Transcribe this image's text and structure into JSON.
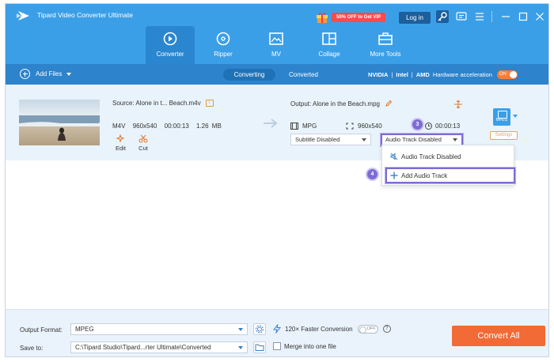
{
  "app": {
    "title": "Tipard Video Converter Ultimate",
    "promo": "50% OFF to Get VIP",
    "login": "Log in"
  },
  "nav": [
    {
      "label": "Converter",
      "icon": "converter-icon",
      "active": true
    },
    {
      "label": "Ripper",
      "icon": "ripper-disc-icon"
    },
    {
      "label": "MV",
      "icon": "mv-image-icon"
    },
    {
      "label": "Collage",
      "icon": "collage-grid-icon"
    },
    {
      "label": "More Tools",
      "icon": "toolbox-icon"
    }
  ],
  "toolbar": {
    "add_files": "Add Files",
    "tab_converting": "Converting",
    "tab_converted": "Converted",
    "gpu_nvidia": "NVIDIA",
    "gpu_intel": "Intel",
    "gpu_amd": "AMD",
    "hw_accel": "Hardware acceleration",
    "hw_accel_state": "ON"
  },
  "file": {
    "source": "Source: Alone in t... Beach.m4v",
    "source_format": "M4V",
    "source_resolution": "960x540",
    "source_duration": "00:00:13",
    "source_size": "1.26 MB",
    "edit": "Edit",
    "cut": "Cut",
    "output": "Output: Alone in the Beach.mpg",
    "out_format": "MPG",
    "out_resolution": "960x540",
    "out_duration": "00:00:13",
    "subtitle": "Subtitle Disabled",
    "audio": "Audio Track Disabled",
    "format_badge": "MPEG",
    "settings": "Settings"
  },
  "badges": {
    "step3": "3",
    "step4": "4"
  },
  "dropdown": {
    "item_disabled": "Audio Track Disabled",
    "item_add": "Add Audio Track"
  },
  "footer": {
    "output_format_label": "Output Format:",
    "output_format_value": "MPEG",
    "save_to_label": "Save to:",
    "save_to_value": "C:\\Tipard Studio\\Tipard...rter Ultimate\\Converted",
    "faster": "120× Faster Conversion",
    "faster_state": "OFF",
    "merge": "Merge into one file",
    "convert_all": "Convert All"
  },
  "colors": {
    "header": "#3b9fe8",
    "toolbar": "#2d83cc",
    "accent_orange": "#f26a35",
    "highlight_purple": "#7d6bd4"
  }
}
